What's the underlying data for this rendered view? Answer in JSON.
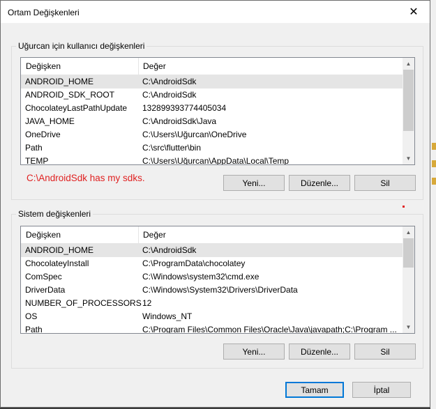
{
  "window": {
    "title": "Ortam Değişkenleri",
    "close_glyph": "✕"
  },
  "user_group": {
    "label": "Uğurcan için kullanıcı değişkenleri",
    "columns": [
      "Değişken",
      "Değer"
    ],
    "rows": [
      {
        "name": "ANDROID_HOME",
        "value": "C:\\AndroidSdk",
        "selected": true
      },
      {
        "name": "ANDROID_SDK_ROOT",
        "value": "C:\\AndroidSdk"
      },
      {
        "name": "ChocolateyLastPathUpdate",
        "value": "132899393774405034"
      },
      {
        "name": "JAVA_HOME",
        "value": "C:\\AndroidSdk\\Java"
      },
      {
        "name": "OneDrive",
        "value": "C:\\Users\\Uğurcan\\OneDrive"
      },
      {
        "name": "Path",
        "value": "C:\\src\\flutter\\bin"
      },
      {
        "name": "TEMP",
        "value": "C:\\Users\\Uğurcan\\AppData\\Local\\Temp"
      }
    ],
    "buttons": {
      "new": "Yeni...",
      "edit": "Düzenle...",
      "delete": "Sil"
    }
  },
  "annotation": "C:\\AndroidSdk has my sdks.",
  "system_group": {
    "label": "Sistem değişkenleri",
    "columns": [
      "Değişken",
      "Değer"
    ],
    "rows": [
      {
        "name": "ANDROID_HOME",
        "value": "C:\\AndroidSdk",
        "selected": true
      },
      {
        "name": "ChocolateyInstall",
        "value": "C:\\ProgramData\\chocolatey"
      },
      {
        "name": "ComSpec",
        "value": "C:\\Windows\\system32\\cmd.exe"
      },
      {
        "name": "DriverData",
        "value": "C:\\Windows\\System32\\Drivers\\DriverData"
      },
      {
        "name": "NUMBER_OF_PROCESSORS",
        "value": "12"
      },
      {
        "name": "OS",
        "value": "Windows_NT"
      },
      {
        "name": "Path",
        "value": "C:\\Program Files\\Common Files\\Oracle\\Java\\javapath;C:\\Program ..."
      }
    ],
    "buttons": {
      "new": "Yeni...",
      "edit": "Düzenle...",
      "delete": "Sil"
    }
  },
  "footer": {
    "ok": "Tamam",
    "cancel": "İptal"
  },
  "colors": {
    "accent": "#0078d7",
    "annotation": "#e02020",
    "selection": "#e5e5e5"
  }
}
